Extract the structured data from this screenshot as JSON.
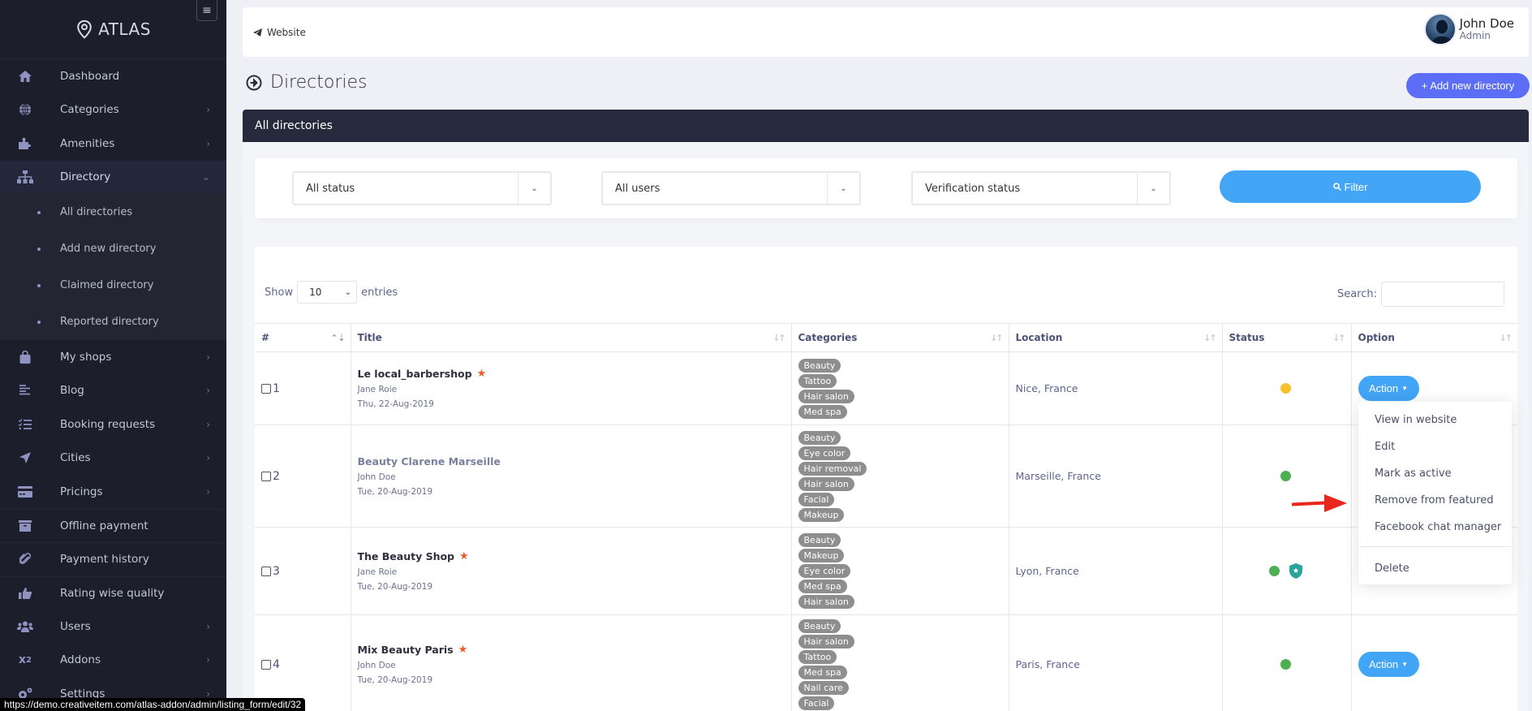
{
  "sidebar": {
    "brand": "ATLAS",
    "items": [
      {
        "label": "Dashboard",
        "icon": "home-icon",
        "chevron": false
      },
      {
        "label": "Categories",
        "icon": "globe-icon",
        "chevron": true
      },
      {
        "label": "Amenities",
        "icon": "puzzle-icon",
        "chevron": true
      },
      {
        "label": "Directory",
        "icon": "sitemap-icon",
        "chevron": true,
        "expanded": true
      }
    ],
    "directory_sub": [
      {
        "label": "All directories"
      },
      {
        "label": "Add new directory"
      },
      {
        "label": "Claimed directory"
      },
      {
        "label": "Reported directory"
      }
    ],
    "items_after": [
      {
        "label": "My shops",
        "icon": "shopping-bag-icon",
        "chevron": true
      },
      {
        "label": "Blog",
        "icon": "align-left-icon",
        "chevron": true
      },
      {
        "label": "Booking requests",
        "icon": "tasks-icon",
        "chevron": true
      },
      {
        "label": "Cities",
        "icon": "location-arrow-icon",
        "chevron": true
      },
      {
        "label": "Pricings",
        "icon": "credit-card-icon",
        "chevron": true
      },
      {
        "label": "Offline payment",
        "icon": "archive-icon",
        "chevron": false
      },
      {
        "label": "Payment history",
        "icon": "paperclip-icon",
        "chevron": false
      },
      {
        "label": "Rating wise quality",
        "icon": "thumbs-up-icon",
        "chevron": false
      },
      {
        "label": "Users",
        "icon": "users-icon",
        "chevron": true
      },
      {
        "label": "Addons",
        "icon": "superscript-icon",
        "chevron": true
      },
      {
        "label": "Settings",
        "icon": "cogs-icon",
        "chevron": true
      }
    ]
  },
  "status_url": "https://demo.creativeitem.com/atlas-addon/admin/listing_form/edit/32",
  "topbar": {
    "website_label": "Website",
    "user_name": "John Doe",
    "user_role": "Admin"
  },
  "page": {
    "title": "Directories",
    "add_button": "+ Add new directory",
    "card_title": "All directories"
  },
  "filters": {
    "status": "All status",
    "users": "All users",
    "verification": "Verification status",
    "filter_button": "Filter"
  },
  "table": {
    "show_label": "Show",
    "entries_value": "10",
    "entries_label": "entries",
    "search_label": "Search:",
    "columns": [
      "#",
      "Title",
      "Categories",
      "Location",
      "Status",
      "Option"
    ],
    "rows": [
      {
        "num": "1",
        "title": "Le local_barbershop",
        "featured": true,
        "muted": false,
        "author": "Jane Roie",
        "date": "Thu, 22-Aug-2019",
        "categories": [
          "Beauty",
          "Tattoo",
          "Hair salon",
          "Med spa"
        ],
        "location": "Nice, France",
        "status_color": "#fbc02d",
        "verified": false,
        "action": "Action"
      },
      {
        "num": "2",
        "title": "Beauty Clarene Marseille",
        "featured": false,
        "muted": true,
        "author": "John Doe",
        "date": "Tue, 20-Aug-2019",
        "categories": [
          "Beauty",
          "Eye color",
          "Hair removal",
          "Hair salon",
          "Facial",
          "Makeup"
        ],
        "location": "Marseille, France",
        "status_color": "#4caf50",
        "verified": false,
        "action": ""
      },
      {
        "num": "3",
        "title": "The Beauty Shop",
        "featured": true,
        "muted": false,
        "author": "Jane Roie",
        "date": "Tue, 20-Aug-2019",
        "categories": [
          "Beauty",
          "Makeup",
          "Eye color",
          "Med spa",
          "Hair salon"
        ],
        "location": "Lyon, France",
        "status_color": "#4caf50",
        "verified": true,
        "action": ""
      },
      {
        "num": "4",
        "title": "Mix Beauty Paris",
        "featured": true,
        "muted": false,
        "author": "John Doe",
        "date": "Tue, 20-Aug-2019",
        "categories": [
          "Beauty",
          "Hair salon",
          "Tattoo",
          "Med spa",
          "Nail care",
          "Facial"
        ],
        "location": "Paris, France",
        "status_color": "#4caf50",
        "verified": false,
        "action": "Action"
      }
    ]
  },
  "dropdown": {
    "items": [
      "View in website",
      "Edit",
      "Mark as active",
      "Remove from featured",
      "Facebook chat manager"
    ],
    "danger_item": "Delete"
  },
  "colors": {
    "sidebar_bg": "#1c1e2b",
    "accent_blue": "#42a5f5",
    "add_button": "#5b6ef5",
    "card_header": "#272a3d",
    "featured_star": "#ef5a28",
    "verified_shield": "#26a69a",
    "annotation_arrow": "#e8261b"
  }
}
